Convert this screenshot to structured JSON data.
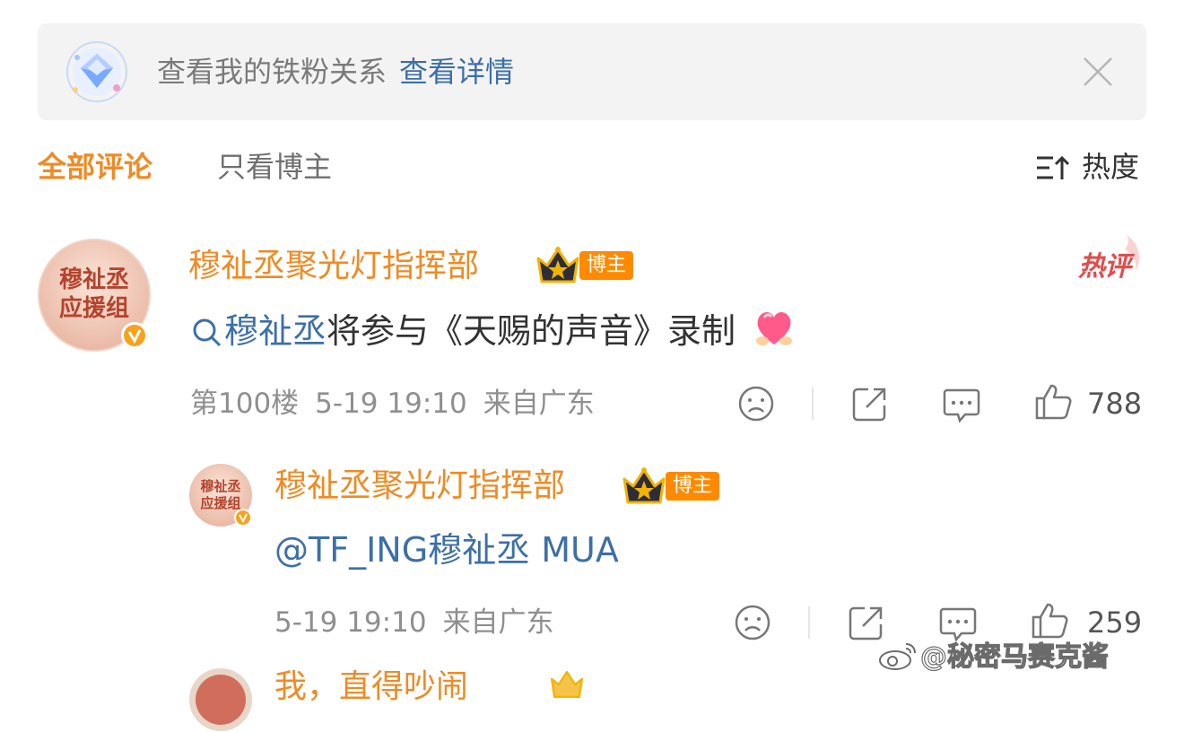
{
  "banner": {
    "text": "查看我的铁粉关系",
    "link": "查看详情",
    "icon": "diamond-badge-icon",
    "close_icon": "close-icon"
  },
  "tabs": {
    "all": "全部评论",
    "blogger_only": "只看博主"
  },
  "sort": {
    "label": "热度",
    "icon": "sort-icon"
  },
  "comments": [
    {
      "username": "穆祉丞聚光灯指挥部",
      "badge": "博主",
      "hot_label": "热评",
      "topic": "穆祉丞",
      "text": "将参与《天赐的声音》录制",
      "emoji": "heart-emoji-icon",
      "floor": "第100楼",
      "time": "5-19 19:10",
      "location": "来自广东",
      "likes": "788",
      "avatar_text": [
        "穆祉丞",
        "应援组"
      ]
    }
  ],
  "replies": [
    {
      "username": "穆祉丞聚光灯指挥部",
      "badge": "博主",
      "mention": "@TF_ING穆祉丞",
      "text": " MUA",
      "time": "5-19 19:10",
      "location": "来自广东",
      "likes": "259",
      "avatar_text": [
        "穆祉丞",
        "应援组"
      ]
    }
  ],
  "next_comment": {
    "username_partial": "我，直得吵闹"
  },
  "watermark": "@秘密马赛克酱",
  "colors": {
    "accent": "#f08a24",
    "link": "#3d6fa8",
    "badge": "#ff8a00",
    "hot": "#e24c4c"
  }
}
